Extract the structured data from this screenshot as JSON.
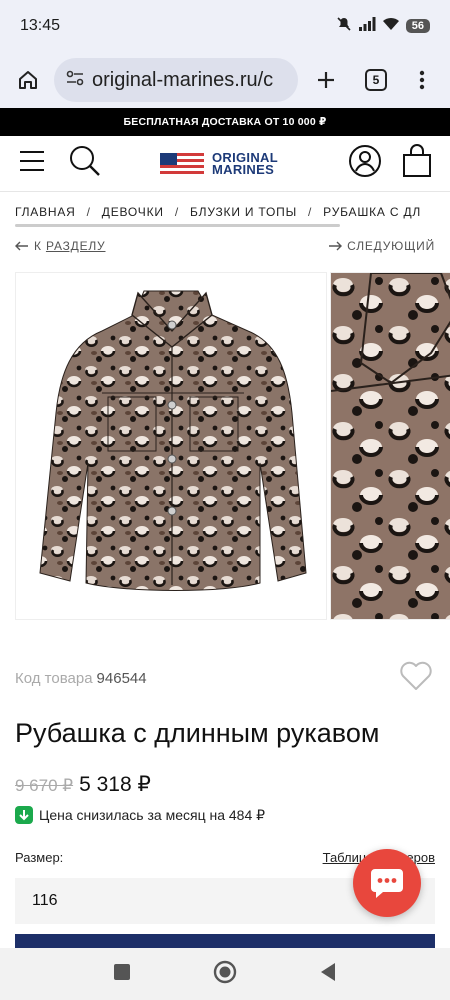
{
  "status_bar": {
    "time": "13:45",
    "battery": "56"
  },
  "browser": {
    "url": "original-marines.ru/c",
    "tab_count": "5"
  },
  "promo": {
    "text": "БЕСПЛАТНАЯ ДОСТАВКА ОТ 10 000 ₽"
  },
  "header": {
    "logo_line1": "ORIGINAL",
    "logo_line2": "MARINES"
  },
  "breadcrumb": {
    "items": [
      "ГЛАВНАЯ",
      "ДЕВОЧКИ",
      "БЛУЗКИ И ТОПЫ",
      "РУБАШКА С ДЛ"
    ],
    "separator": "/"
  },
  "nav": {
    "back_prefix": "К ",
    "back_link": "РАЗДЕЛУ",
    "next": "СЛЕДУЮЩИЙ"
  },
  "product": {
    "sku_label": "Код товара",
    "sku": "946544",
    "title": "Рубашка с длинным рукавом",
    "old_price": "9 670 ₽",
    "new_price": "5 318 ₽",
    "price_drop": "Цена снизилась за месяц на 484 ₽",
    "size_label": "Размер:",
    "size_table": "Таблица размеров",
    "size_selected": "116"
  },
  "colors": {
    "accent": "#1d2f68",
    "chat": "#e8473d",
    "drop": "#1ba94c"
  }
}
